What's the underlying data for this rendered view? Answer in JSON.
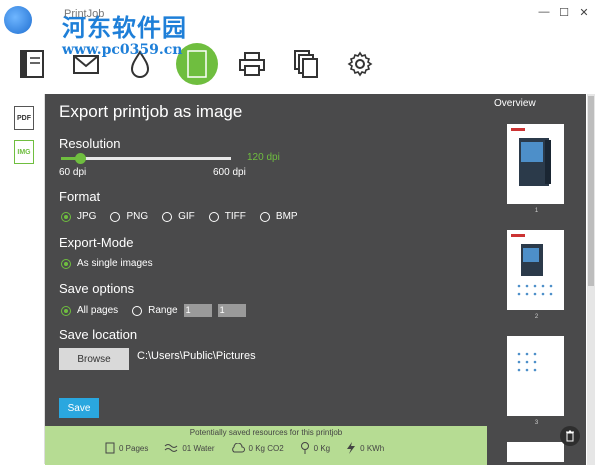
{
  "window": {
    "title": "PrintJob",
    "controls": {
      "minimize": "—",
      "maximize": "☐",
      "close": "✕"
    }
  },
  "watermark": {
    "site_name": "河东软件园",
    "site_url": "www.pc0359.cn"
  },
  "toolbar": {
    "items": [
      {
        "name": "document-icon"
      },
      {
        "name": "mail-icon"
      },
      {
        "name": "ink-drop-icon"
      },
      {
        "name": "image-export-icon",
        "active": true,
        "label": "IMG"
      },
      {
        "name": "printer-icon"
      },
      {
        "name": "copies-icon"
      },
      {
        "name": "gear-icon"
      }
    ]
  },
  "left_formats": {
    "pdf": "PDF",
    "img": "IMG"
  },
  "main": {
    "title": "Export printjob as image",
    "resolution": {
      "label": "Resolution",
      "value_text": "120 dpi",
      "min_text": "60 dpi",
      "max_text": "600 dpi",
      "value": 120,
      "min": 60,
      "max": 600
    },
    "format": {
      "label": "Format",
      "options": [
        "JPG",
        "PNG",
        "GIF",
        "TIFF",
        "BMP"
      ],
      "selected": "JPG"
    },
    "export_mode": {
      "label": "Export-Mode",
      "option": "As single images"
    },
    "save_options": {
      "label": "Save options",
      "all_pages": "All pages",
      "range": "Range",
      "range_from": "1",
      "range_to": "1"
    },
    "save_location": {
      "label": "Save location",
      "browse": "Browse",
      "path": "C:\\Users\\Public\\Pictures"
    },
    "save_button": "Save"
  },
  "footer": {
    "title": "Potentially saved resources for this printjob",
    "stats": {
      "pages": "0 Pages",
      "water": "01 Water",
      "co2": "0 Kg  CO2",
      "kg": "0 Kg",
      "kwh": "0 KWh"
    }
  },
  "overview": {
    "title": "Overview",
    "pages": [
      "1",
      "2",
      "3"
    ]
  },
  "colors": {
    "accent": "#6fbe3f",
    "panel": "#4a4a4b",
    "save": "#2aa7df",
    "footer": "#b6dc93"
  }
}
